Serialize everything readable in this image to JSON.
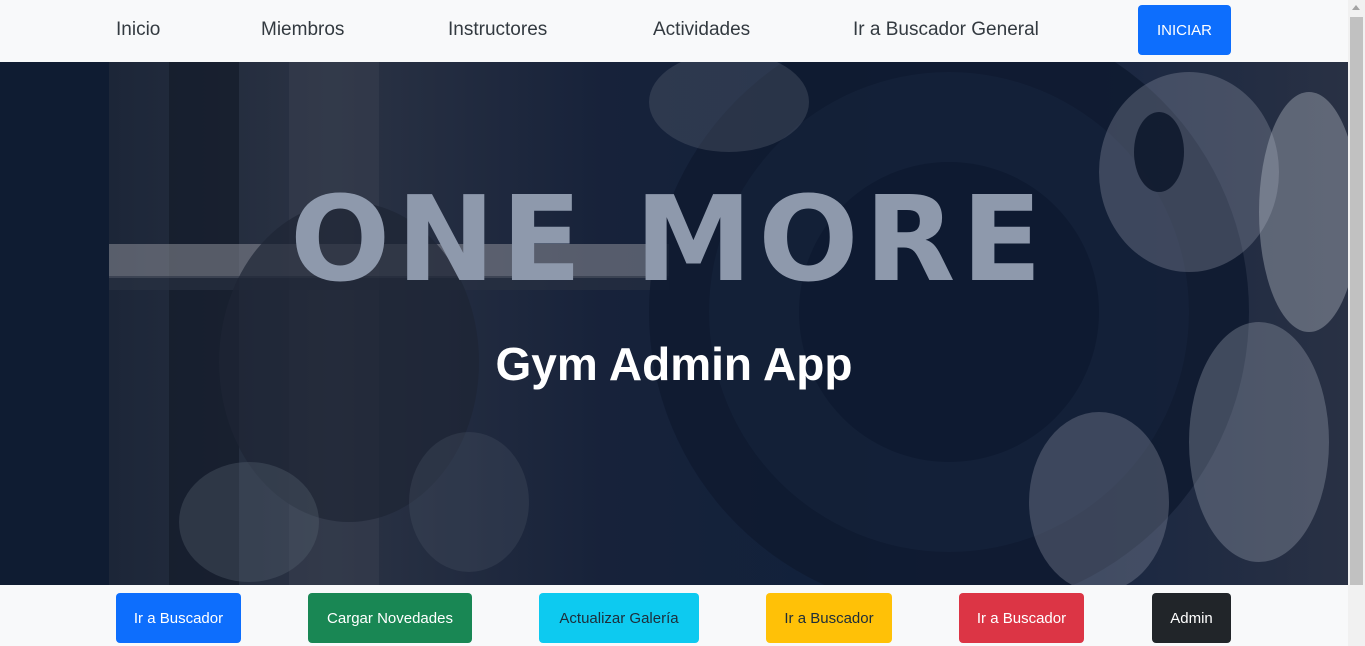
{
  "nav": {
    "items": [
      {
        "label": "Inicio"
      },
      {
        "label": "Miembros"
      },
      {
        "label": "Instructores"
      },
      {
        "label": "Actividades"
      },
      {
        "label": "Ir a Buscador General"
      }
    ],
    "login_label": "INICIAR"
  },
  "hero": {
    "brand_text": "ONE MORE",
    "title": "Gym Admin App"
  },
  "actions": [
    {
      "label": "Ir a Buscador",
      "color": "#0d6efd"
    },
    {
      "label": "Cargar Novedades",
      "color": "#198754"
    },
    {
      "label": "Actualizar Galería",
      "color": "#0dcaf0"
    },
    {
      "label": "Ir a Buscador",
      "color": "#ffc107"
    },
    {
      "label": "Ir a Buscador",
      "color": "#dc3545"
    },
    {
      "label": "Admin",
      "color": "#212529"
    }
  ],
  "colors": {
    "primary": "#0d6efd",
    "navbar_bg": "#f8f9fa",
    "hero_bg": "#0f1c32"
  }
}
